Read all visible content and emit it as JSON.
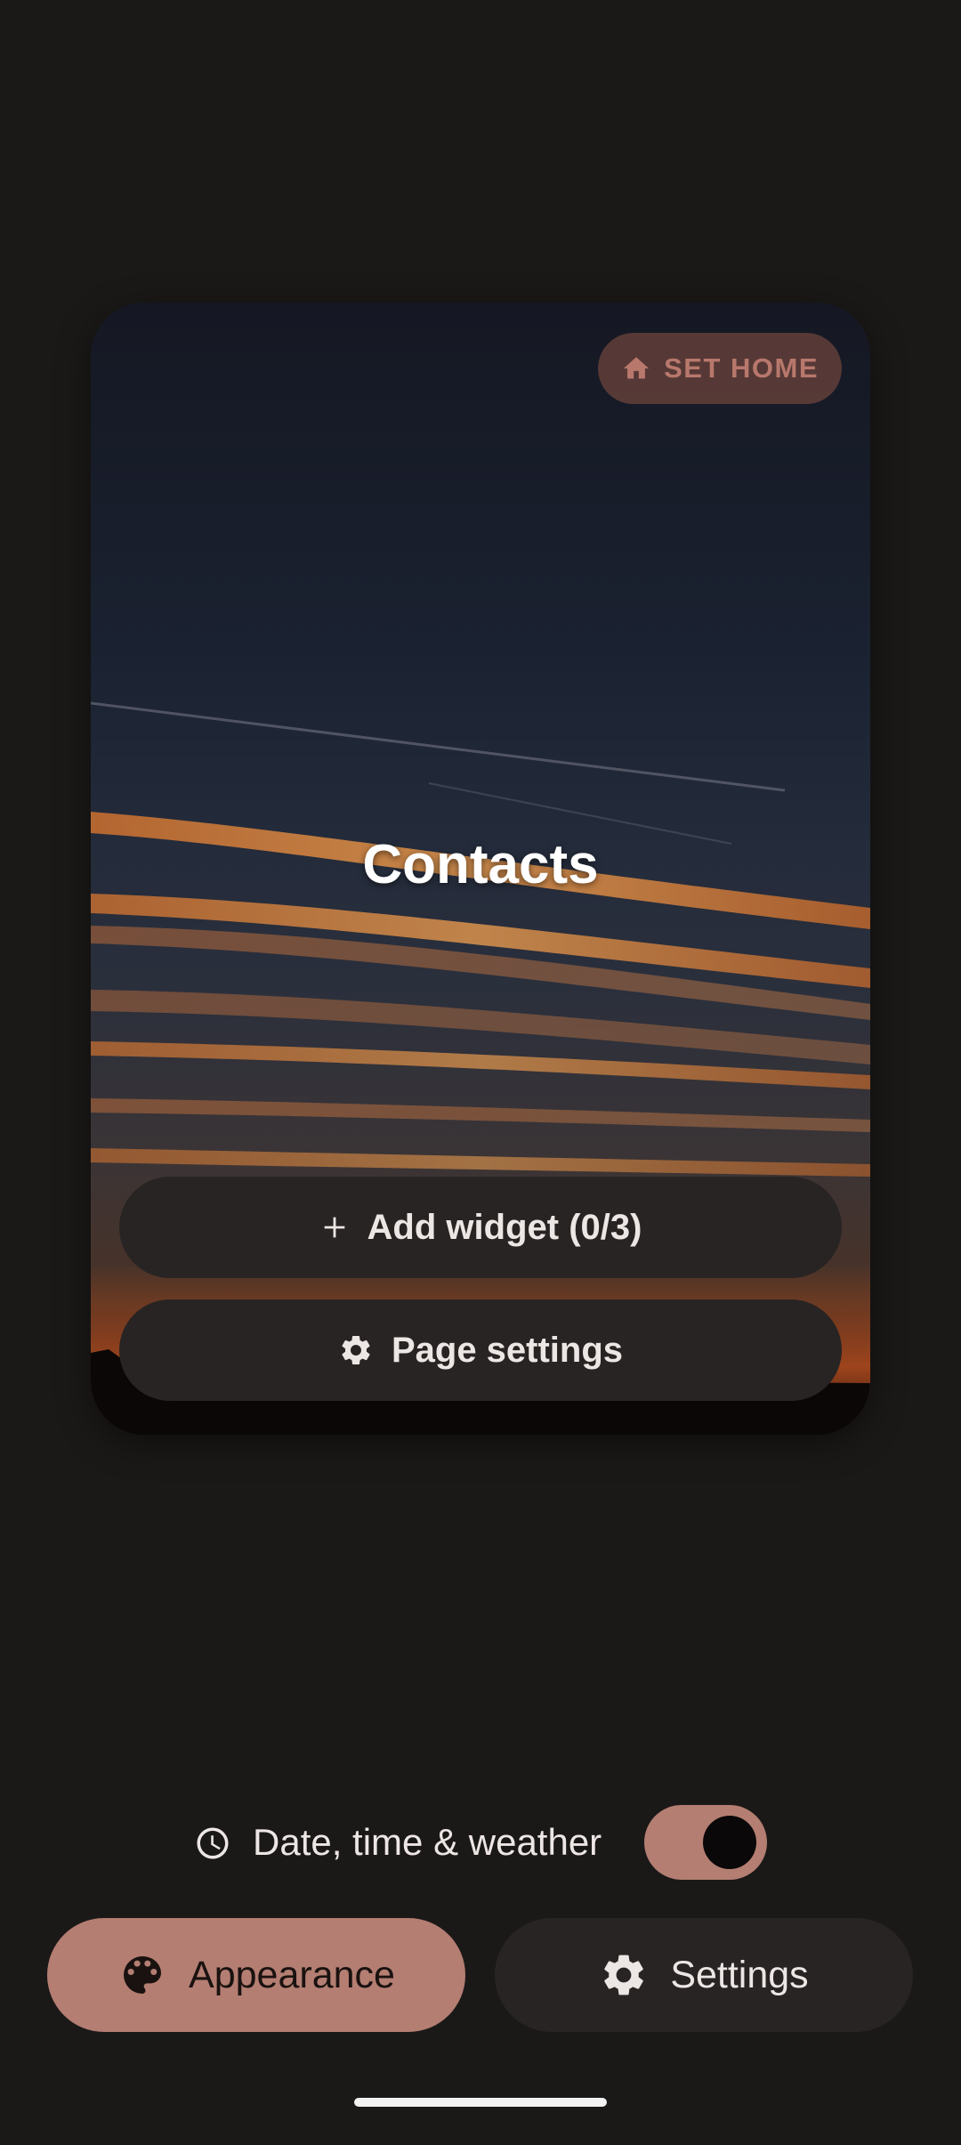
{
  "page_card": {
    "title": "Contacts",
    "set_home_label": "SET HOME",
    "add_widget_label": "Add widget (0/3)",
    "page_settings_label": "Page settings"
  },
  "date_time_toggle": {
    "label": "Date, time & weather",
    "enabled": true
  },
  "bottom_bar": {
    "appearance_label": "Appearance",
    "settings_label": "Settings"
  },
  "icons": {
    "set_home": "home-icon",
    "add_widget": "plus-icon",
    "page_settings": "gear-icon",
    "date_time": "clock-icon",
    "appearance": "palette-icon",
    "settings": "gear-icon"
  },
  "colors": {
    "background": "#1b1918",
    "accent": "#b47e72",
    "button_dark": "#282423",
    "set_home_text": "#b8786c",
    "text_light": "#ece6e4"
  }
}
